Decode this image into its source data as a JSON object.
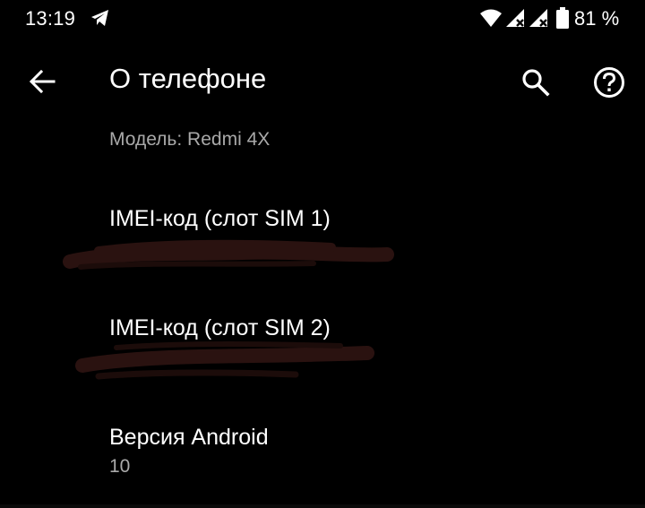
{
  "status_bar": {
    "time": "13:19",
    "battery_percent": "81 %",
    "icons": [
      "telegram-icon",
      "wifi-icon",
      "signal-icon",
      "signal-icon",
      "battery-icon"
    ]
  },
  "app_bar": {
    "title": "О телефоне",
    "icons": [
      "back-arrow-icon",
      "search-icon",
      "help-icon"
    ]
  },
  "list": {
    "model": {
      "subtitle": "Модель: Redmi 4X"
    },
    "imei1": {
      "title": "IMEI-код (слот SIM 1)"
    },
    "imei2": {
      "title": "IMEI-код (слот SIM 2)"
    },
    "android": {
      "title": "Версия Android",
      "subtitle": "10"
    }
  },
  "colors": {
    "background": "#000000",
    "primary_text": "#ffffff",
    "secondary_text": "#a9a9a9",
    "redaction": "#2a1210"
  }
}
